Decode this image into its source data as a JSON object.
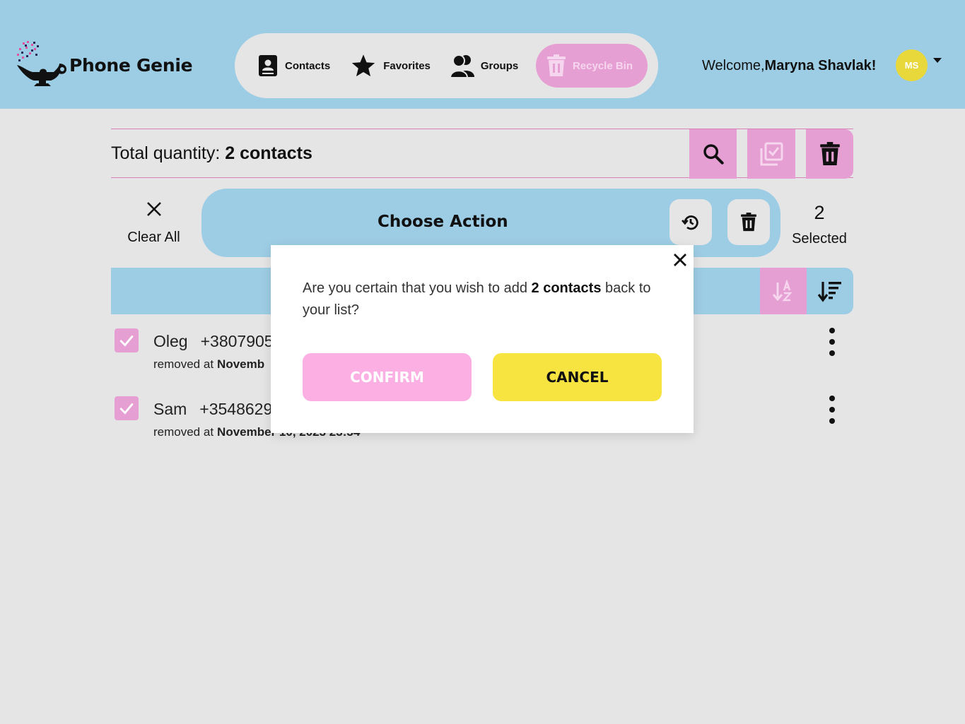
{
  "app": {
    "name": "Phone Genie"
  },
  "nav": {
    "items": [
      {
        "label": "Contacts",
        "icon": "contact-book-icon"
      },
      {
        "label": "Favorites",
        "icon": "star-icon"
      },
      {
        "label": "Groups",
        "icon": "users-icon"
      },
      {
        "label": "Recycle Bin",
        "icon": "trash-icon",
        "active": true
      }
    ]
  },
  "user": {
    "welcome_prefix": "Welcome,",
    "name": "Maryna Shavlak!",
    "initials": "MS"
  },
  "totals": {
    "prefix": "Total quantity:",
    "value": "2 contacts"
  },
  "actions": {
    "clear_all": "Clear All",
    "title": "Choose Action",
    "selected_count": "2",
    "selected_label": "Selected"
  },
  "contacts": [
    {
      "name": "Oleg",
      "phone": "+3807905",
      "removed_label": "removed at",
      "removed_at": "Novemb"
    },
    {
      "name": "Sam",
      "phone": "+3548629",
      "removed_label": "removed at",
      "removed_at": "November 10, 2023 23:34"
    }
  ],
  "modal": {
    "text_before": "Are you certain that you wish to add ",
    "text_bold": "2 contacts",
    "text_after": " back to your list?",
    "confirm_label": "CONFIRM",
    "cancel_label": "CANCEL"
  },
  "colors": {
    "header": "#9dcde5",
    "accent_pink": "#e69fd3",
    "confirm_pink": "#fbafe3",
    "cancel_yellow": "#f7e441",
    "avatar": "#e9d83b",
    "background": "#e5e5e5"
  }
}
